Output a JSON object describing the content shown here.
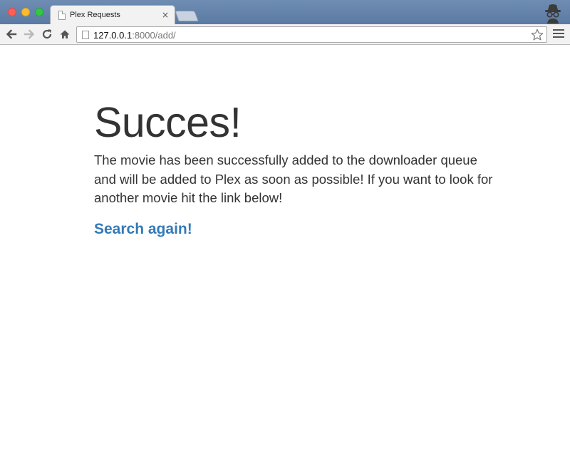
{
  "browser": {
    "tab": {
      "title": "Plex Requests",
      "close_glyph": "×",
      "icon": "page-icon"
    },
    "address_bar": {
      "url_host": "127.0.0.1",
      "url_rest": ":8000/add/"
    },
    "icons": {
      "back": "arrow-left-icon",
      "forward": "arrow-right-icon",
      "reload": "reload-icon",
      "home": "home-icon",
      "bookmark": "star-icon",
      "menu": "hamburger-menu-icon",
      "profile": "incognito-icon"
    },
    "colors": {
      "titlebar": "#6f8db3",
      "toolbar": "#f2f2f2"
    }
  },
  "page": {
    "heading": "Succes!",
    "message": "The movie has been successfully added to the downloader queue and will be added to Plex as soon as possible! If you want to look for another movie hit the link below!",
    "link_label": "Search again!",
    "colors": {
      "text": "#333333",
      "link": "#337ab7"
    }
  }
}
